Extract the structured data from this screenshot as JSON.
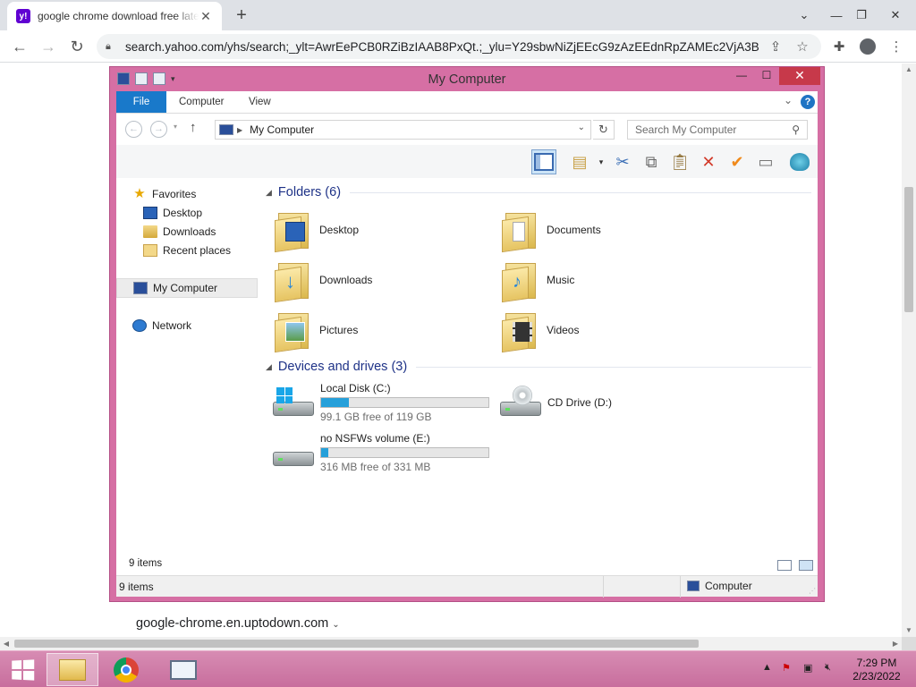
{
  "browser": {
    "tab": {
      "favicon": "yahoo-favicon",
      "favicon_letter": "y!",
      "title": "google chrome download free latest version - Yahoo Search"
    },
    "url": "search.yahoo.com/yhs/search;_ylt=AwrEePCB0RZiBzIAAB8PxQt.;_ylu=Y29sbwNiZjEEcG9zAzEEdnRpZAMEc2VjA3B..."
  },
  "explorer": {
    "window_title": "My Computer",
    "ribbon_tabs": [
      "File",
      "Computer",
      "View"
    ],
    "address_location": "My Computer",
    "search_placeholder": "Search My Computer",
    "nav": {
      "favorites": "Favorites",
      "desktop": "Desktop",
      "downloads": "Downloads",
      "recent": "Recent places",
      "my_computer": "My Computer",
      "network": "Network"
    },
    "folders_header": "Folders (6)",
    "folders": [
      "Desktop",
      "Documents",
      "Downloads",
      "Music",
      "Pictures",
      "Videos"
    ],
    "devices_header": "Devices and drives (3)",
    "drives": [
      {
        "name": "Local Disk (C:)",
        "free": "99.1 GB free of 119 GB",
        "used_fraction": 0.167
      },
      {
        "name": "CD Drive (D:)"
      },
      {
        "name": "no NSFWs volume (E:)",
        "free": "316 MB free of 331 MB",
        "used_fraction": 0.045
      }
    ],
    "items_count_inner": "9 items",
    "status_left": "9 items",
    "status_right": "Computer"
  },
  "page": {
    "site_link": "google-chrome.en.uptodown.com"
  },
  "taskbar": {
    "time": "7:29 PM",
    "date": "2/23/2022"
  },
  "colors": {
    "window_frame": "#d66fa4",
    "ribbon_file": "#1979ca",
    "progress": "#26a0da",
    "taskbar": "#cc77a5"
  }
}
